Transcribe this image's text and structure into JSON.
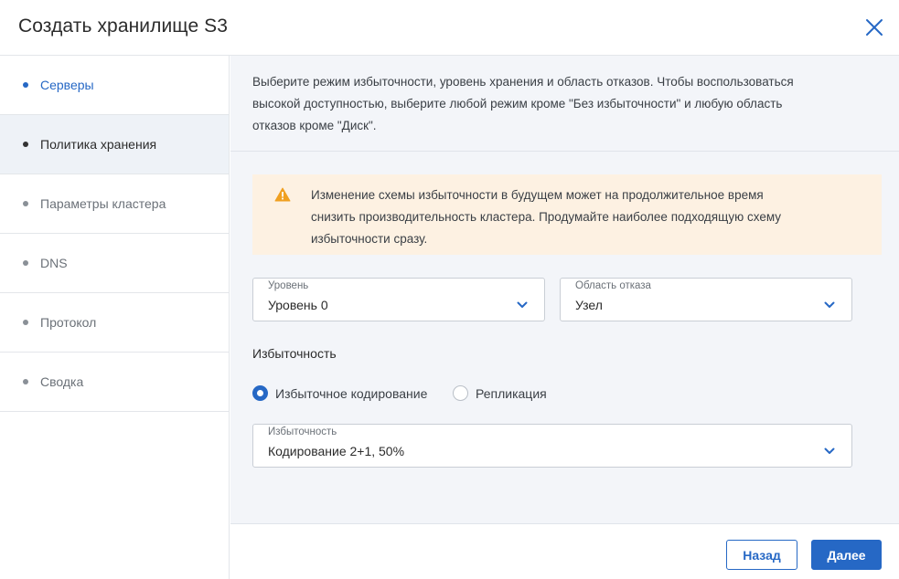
{
  "dialog": {
    "title": "Создать хранилище S3"
  },
  "steps": [
    {
      "label": "Серверы",
      "state": "done"
    },
    {
      "label": "Политика хранения",
      "state": "active"
    },
    {
      "label": "Параметры кластера",
      "state": "pending"
    },
    {
      "label": "DNS",
      "state": "pending"
    },
    {
      "label": "Протокол",
      "state": "pending"
    },
    {
      "label": "Сводка",
      "state": "pending"
    }
  ],
  "description": {
    "line1": "Выберите режим избыточности, уровень хранения и область отказов. Чтобы воспользоваться",
    "line2": "высокой доступностью, выберите любой режим кроме \"Без избыточности\" и любую область",
    "line3": "отказов кроме \"Диск\"."
  },
  "warning": {
    "line1": "Изменение схемы избыточности в будущем может на продолжительное время",
    "line2": "снизить производительность кластера. Продумайте наиболее подходящую схему",
    "line3": "избыточности сразу."
  },
  "tier_select": {
    "label": "Уровень",
    "value": "Уровень 0"
  },
  "failure_domain_select": {
    "label": "Область отказа",
    "value": "Узел"
  },
  "redundancy": {
    "title": "Избыточность",
    "option_ec": "Избыточное кодирование",
    "option_replication": "Репликация",
    "selected": "ec"
  },
  "redundancy_select": {
    "label": "Избыточность",
    "value": "Кодирование 2+1, 50%"
  },
  "footer": {
    "back_label": "Назад",
    "next_label": "Далее"
  },
  "colors": {
    "accent": "#2668c5",
    "warning_bg": "#fdf1e2",
    "warning_icon": "#f0a020"
  }
}
